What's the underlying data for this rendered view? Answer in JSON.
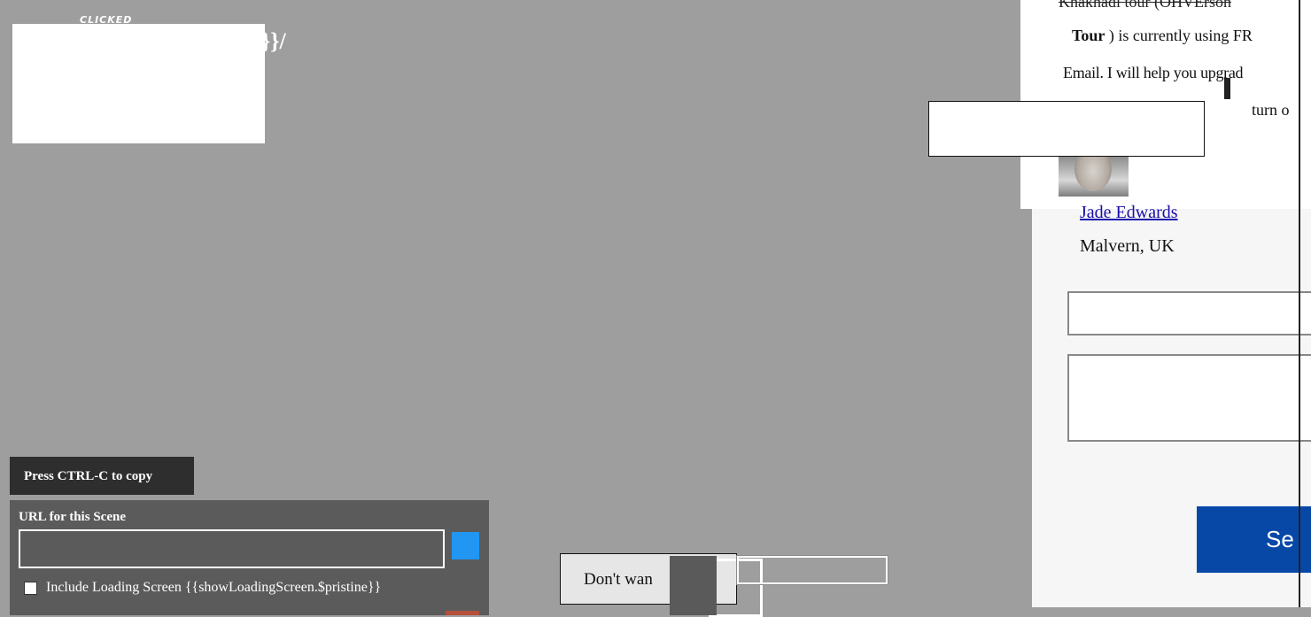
{
  "overlay": {
    "clicked_label": "CLICKED",
    "frag_1": "}}/",
    "frag_2": "/"
  },
  "panel": {
    "top_strike": "Khakhadi tour (OHVErson",
    "line_1_bold": "Tour",
    "line_1_rest": ") is currently using FR",
    "line_2": "Email. I will help you upgrad",
    "line_3": "turn o",
    "author_name": "Jade Edwards",
    "location": "Malvern, UK",
    "send_label": "Se"
  },
  "copy": {
    "tooltip": "Press CTRL-C to copy",
    "url_title": "URL for this Scene",
    "url_value": "",
    "checkbox_label": "Include Loading Screen {{showLoadingScreen.$pristine}}"
  },
  "bottom": {
    "dont_label": "Don't wan"
  },
  "icons": {
    "copy_button": "copy-icon",
    "avatar": "person-avatar"
  },
  "colors": {
    "background": "#9e9e9e",
    "send_button": "#0748a7",
    "copy_button": "#2196f3",
    "author_link": "#1a0dab"
  }
}
